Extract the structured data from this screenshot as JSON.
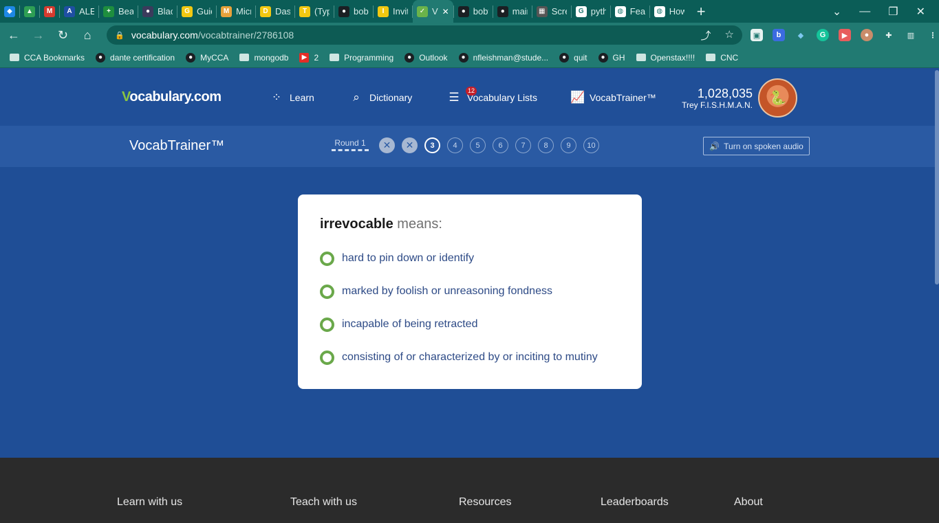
{
  "browser": {
    "tabs": [
      {
        "label": "",
        "color": "#1e88e5",
        "glyph": "◆"
      },
      {
        "label": "",
        "color": "#2e9e54",
        "glyph": "▲"
      },
      {
        "label": "",
        "color": "#d63b2f",
        "glyph": "M"
      },
      {
        "label": "ALE",
        "color": "#1f4fa3",
        "glyph": "A"
      },
      {
        "label": "Beat",
        "color": "#1e8e3e",
        "glyph": "+"
      },
      {
        "label": "Blac",
        "color": "#3b3b5c",
        "glyph": "●"
      },
      {
        "label": "Guid",
        "color": "#f2c811",
        "glyph": "G"
      },
      {
        "label": "Micr",
        "color": "#e8a23b",
        "glyph": "M"
      },
      {
        "label": "Dash",
        "color": "#f2c811",
        "glyph": "D"
      },
      {
        "label": "(Typ",
        "color": "#f2c811",
        "glyph": "T"
      },
      {
        "label": "bobt",
        "color": "#1b1f23",
        "glyph": "●"
      },
      {
        "label": "Invit",
        "color": "#f2c811",
        "glyph": "I"
      },
      {
        "label": "V",
        "color": "#6bb34a",
        "glyph": "✓"
      },
      {
        "label": "bobt",
        "color": "#1b1f23",
        "glyph": "●"
      },
      {
        "label": "mair",
        "color": "#1b1f23",
        "glyph": "●"
      },
      {
        "label": "Scre",
        "color": "#555555",
        "glyph": "▦"
      },
      {
        "label": "pyth",
        "color": "#ffffff",
        "glyph": "G"
      },
      {
        "label": "Feat",
        "color": "#ffffff",
        "glyph": "◍"
      },
      {
        "label": "How",
        "color": "#ffffff",
        "glyph": "◍"
      }
    ],
    "new_tab_glyph": "+",
    "url_host": "vocabulary.com",
    "url_path": "/vocabtrainer/2786108",
    "bookmarks": [
      {
        "label": "CCA Bookmarks",
        "type": "folder"
      },
      {
        "label": "dante certification",
        "type": "site"
      },
      {
        "label": "MyCCA",
        "type": "site"
      },
      {
        "label": "mongodb",
        "type": "folder"
      },
      {
        "label": "2",
        "type": "youtube"
      },
      {
        "label": "Programming",
        "type": "folder"
      },
      {
        "label": "Outlook",
        "type": "site"
      },
      {
        "label": "nfleishman@stude...",
        "type": "site"
      },
      {
        "label": "quit",
        "type": "site"
      },
      {
        "label": "GH",
        "type": "site"
      },
      {
        "label": "Openstax!!!!",
        "type": "folder"
      },
      {
        "label": "CNC",
        "type": "folder"
      }
    ]
  },
  "site": {
    "logo_v": "V",
    "logo_rest": "ocabulary.com",
    "nav": {
      "learn": "Learn",
      "dictionary": "Dictionary",
      "lists": "Vocabulary Lists",
      "lists_badge": "12",
      "trainer": "VocabTrainer™"
    },
    "user": {
      "points": "1,028,035",
      "name": "Trey F.I.S.H.M.A.N."
    }
  },
  "trainer": {
    "title": "VocabTrainer™",
    "round_label": "Round 1",
    "progress": [
      {
        "label": "✕",
        "state": "wrong"
      },
      {
        "label": "✕",
        "state": "wrong"
      },
      {
        "label": "3",
        "state": "current"
      },
      {
        "label": "4",
        "state": "pending"
      },
      {
        "label": "5",
        "state": "pending"
      },
      {
        "label": "6",
        "state": "pending"
      },
      {
        "label": "7",
        "state": "pending"
      },
      {
        "label": "8",
        "state": "pending"
      },
      {
        "label": "9",
        "state": "pending"
      },
      {
        "label": "10",
        "state": "pending"
      }
    ],
    "audio_button": "Turn on spoken audio"
  },
  "question": {
    "word": "irrevocable",
    "suffix": "means:",
    "choices": [
      "hard to pin down or identify",
      "marked by foolish or unreasoning fondness",
      "incapable of being retracted",
      "consisting of or characterized by or inciting to mutiny"
    ]
  },
  "footer": {
    "columns": [
      "Learn with us",
      "Teach with us",
      "Resources",
      "Leaderboards",
      "About"
    ]
  }
}
